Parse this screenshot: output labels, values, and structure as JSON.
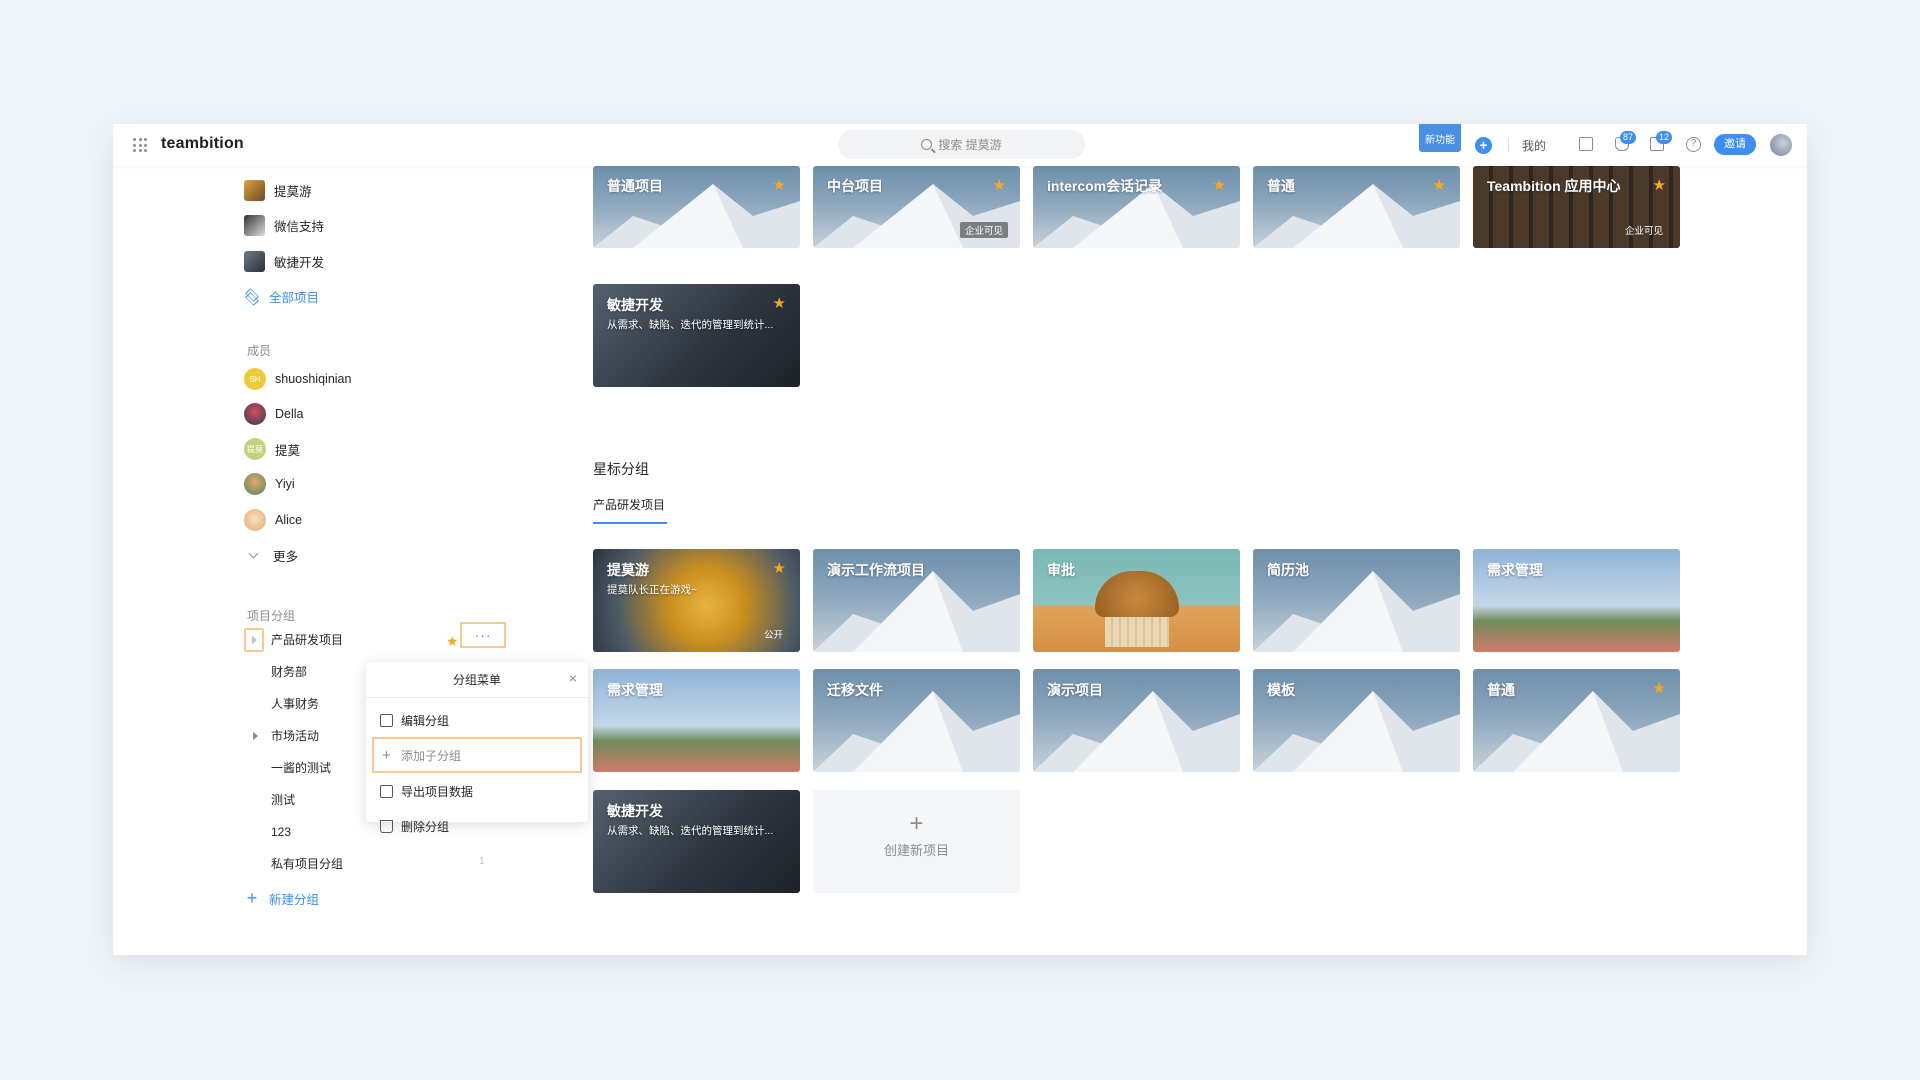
{
  "app": {
    "logo": "teambition"
  },
  "topbar": {
    "search_placeholder": "搜索 提莫游",
    "new_feature": "新功能",
    "mine": "我的",
    "badge_notifications": "87",
    "badge_messages": "12",
    "help": "?",
    "invite": "邀请"
  },
  "sidebar": {
    "projects": [
      {
        "name": "提莫游"
      },
      {
        "name": "微信支持"
      },
      {
        "name": "敏捷开发"
      }
    ],
    "all_projects": "全部项目",
    "members_label": "成员",
    "members": [
      {
        "name": "shuoshiqinian",
        "initials": "SH"
      },
      {
        "name": "Della",
        "initials": ""
      },
      {
        "name": "提莫",
        "initials": "提莫"
      },
      {
        "name": "Yiyi",
        "initials": ""
      },
      {
        "name": "Alice",
        "initials": ""
      }
    ],
    "more": "更多",
    "groups_label": "项目分组",
    "groups": [
      {
        "name": "产品研发项目"
      },
      {
        "name": "财务部"
      },
      {
        "name": "人事财务"
      },
      {
        "name": "市场活动"
      },
      {
        "name": "一酱的测试"
      },
      {
        "name": "测试"
      },
      {
        "name": "123"
      },
      {
        "name": "私有项目分组",
        "count": "1"
      }
    ],
    "new_group": "新建分组",
    "more_dots": "···"
  },
  "popover": {
    "title": "分组菜单",
    "items": [
      {
        "label": "编辑分组"
      },
      {
        "label": "添加子分组"
      },
      {
        "label": "导出项目数据"
      },
      {
        "label": "删除分组"
      }
    ]
  },
  "top_cards": [
    {
      "title": "普通项目",
      "starred": true,
      "tag": ""
    },
    {
      "title": "中台项目",
      "starred": true,
      "tag": "企业可见"
    },
    {
      "title": "intercom会话记录",
      "starred": true,
      "tag": ""
    },
    {
      "title": "普通",
      "starred": true,
      "tag": ""
    },
    {
      "title": "Teambition 应用中心",
      "starred": true,
      "tag": "企业可见"
    },
    {
      "title": "敏捷开发",
      "desc": "从需求、缺陷、迭代的管理到统计...",
      "starred": true,
      "tag": ""
    }
  ],
  "starred_section": {
    "title": "星标分组",
    "tab": "产品研发项目",
    "cards": [
      {
        "title": "提莫游",
        "desc": "提莫队长正在游戏~",
        "starred": true,
        "tag": "公开"
      },
      {
        "title": "演示工作流项目",
        "starred": false
      },
      {
        "title": "审批",
        "starred": false
      },
      {
        "title": "简历池",
        "starred": false
      },
      {
        "title": "需求管理",
        "starred": false
      },
      {
        "title": "需求管理",
        "starred": false
      },
      {
        "title": "迁移文件",
        "starred": false
      },
      {
        "title": "演示项目",
        "starred": false
      },
      {
        "title": "模板",
        "starred": false
      },
      {
        "title": "普通",
        "starred": true
      },
      {
        "title": "敏捷开发",
        "desc": "从需求、缺陷、迭代的管理到统计...",
        "starred": false
      }
    ],
    "create_label": "创建新项目"
  },
  "colors": {
    "accent": "#3d8ef0",
    "star": "#f5a623",
    "highlight": "#f7c992"
  }
}
